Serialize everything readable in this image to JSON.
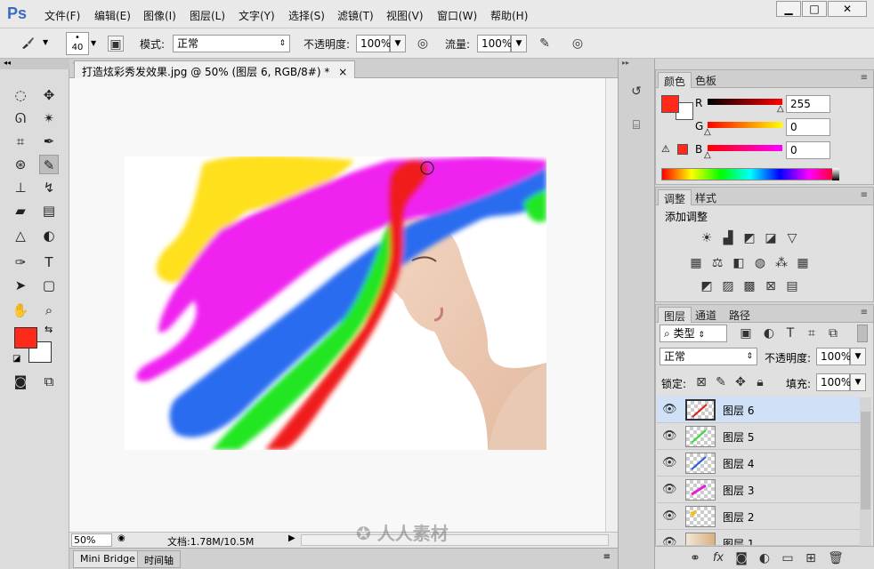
{
  "app": {
    "logo": "Ps"
  },
  "menu": [
    "文件(F)",
    "编辑(E)",
    "图像(I)",
    "图层(L)",
    "文字(Y)",
    "选择(S)",
    "滤镜(T)",
    "视图(V)",
    "窗口(W)",
    "帮助(H)"
  ],
  "window_controls": {
    "minimize": "▁",
    "maximize": "□",
    "close": "✕"
  },
  "options": {
    "brush_size": "40",
    "mode_label": "模式:",
    "mode_value": "正常",
    "opacity_label": "不透明度:",
    "opacity_value": "100%",
    "flow_label": "流量:",
    "flow_value": "100%"
  },
  "document": {
    "tab_title": "打造炫彩秀发效果.jpg @ 50% (图层 6, RGB/8#) *",
    "tab_close": "×",
    "zoom": "50%",
    "doc_info": "文档:1.78M/10.5M"
  },
  "bottom_tabs": [
    "Mini Bridge",
    "时间轴"
  ],
  "color_panel": {
    "tabs": [
      "颜色",
      "色板"
    ],
    "r_label": "R",
    "r_value": "255",
    "g_label": "G",
    "g_value": "0",
    "b_label": "B",
    "b_value": "0",
    "foreground": "#ff2a1a"
  },
  "adjust_panel": {
    "tabs": [
      "调整",
      "样式"
    ],
    "title": "添加调整"
  },
  "layers_panel": {
    "tabs": [
      "图层",
      "通道",
      "路径"
    ],
    "filter_label": "类型",
    "blend_mode": "正常",
    "opacity_label": "不透明度:",
    "opacity_value": "100%",
    "lock_label": "锁定:",
    "fill_label": "填充:",
    "fill_value": "100%",
    "layers": [
      {
        "name": "图层 6",
        "color": "#e02020",
        "selected": true
      },
      {
        "name": "图层 5",
        "color": "#30e030",
        "selected": false
      },
      {
        "name": "图层 4",
        "color": "#2060e0",
        "selected": false
      },
      {
        "name": "图层 3",
        "color": "#e020e0",
        "selected": false
      },
      {
        "name": "图层 2",
        "color": "#f0c020",
        "selected": false
      },
      {
        "name": "图层 1",
        "color": "#d8b080",
        "selected": false
      }
    ],
    "footer_fx": "fx"
  },
  "watermark": "人人素材"
}
